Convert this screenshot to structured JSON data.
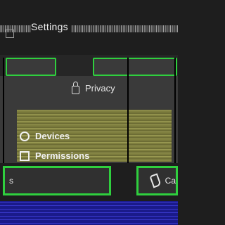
{
  "window": {
    "title": "Settings"
  },
  "tabs": [
    {
      "label": ""
    },
    {
      "label": ""
    }
  ],
  "menu": {
    "privacy": "Privacy",
    "items": [
      {
        "label": "Devices",
        "icon": "devices-icon"
      },
      {
        "label": "Permissions",
        "icon": "permissions-icon"
      }
    ]
  },
  "actions": [
    {
      "label": "s"
    },
    {
      "label": "Ca"
    }
  ],
  "colors": {
    "accent": "#2fcf3e",
    "blue": "#3b3bd0",
    "olive": "#9a9a53"
  }
}
